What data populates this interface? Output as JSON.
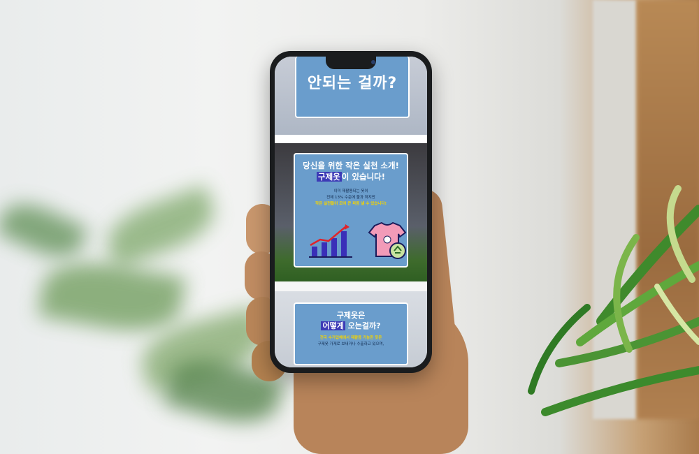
{
  "screen": {
    "card1": {
      "title": "안되는 걸까?"
    },
    "card2": {
      "heading_line1": "당신을 위한 작은 실천 소개!",
      "heading_highlight": "구제옷",
      "heading_line2_rest": "이 있습니다!",
      "body_line1": "이미 재활용되는 옷이",
      "body_line2": "전체 13% 수준에 불과 하지만",
      "body_line3": "작은 실천들이 모여 큰 파동 낼 수 있습니다!",
      "icons": [
        "bar-chart-growth-icon",
        "recycled-tshirt-icon"
      ]
    },
    "card3": {
      "heading_line1": "구제옷은",
      "heading_highlight": "어떻게",
      "heading_line2_rest": "오는걸까?",
      "body_line1": "전국 수거업체에서 재활용 가능한 옷은",
      "body_line2": "구제옷 가게로 보내거나 수출하고 있으며,"
    }
  },
  "colors": {
    "card_blue": "#6a9dcc",
    "highlight": "#3d3bb6",
    "accent_yellow": "#f5d400",
    "chart_purple": "#3a2fb8",
    "tee_pink": "#f29bb8"
  }
}
